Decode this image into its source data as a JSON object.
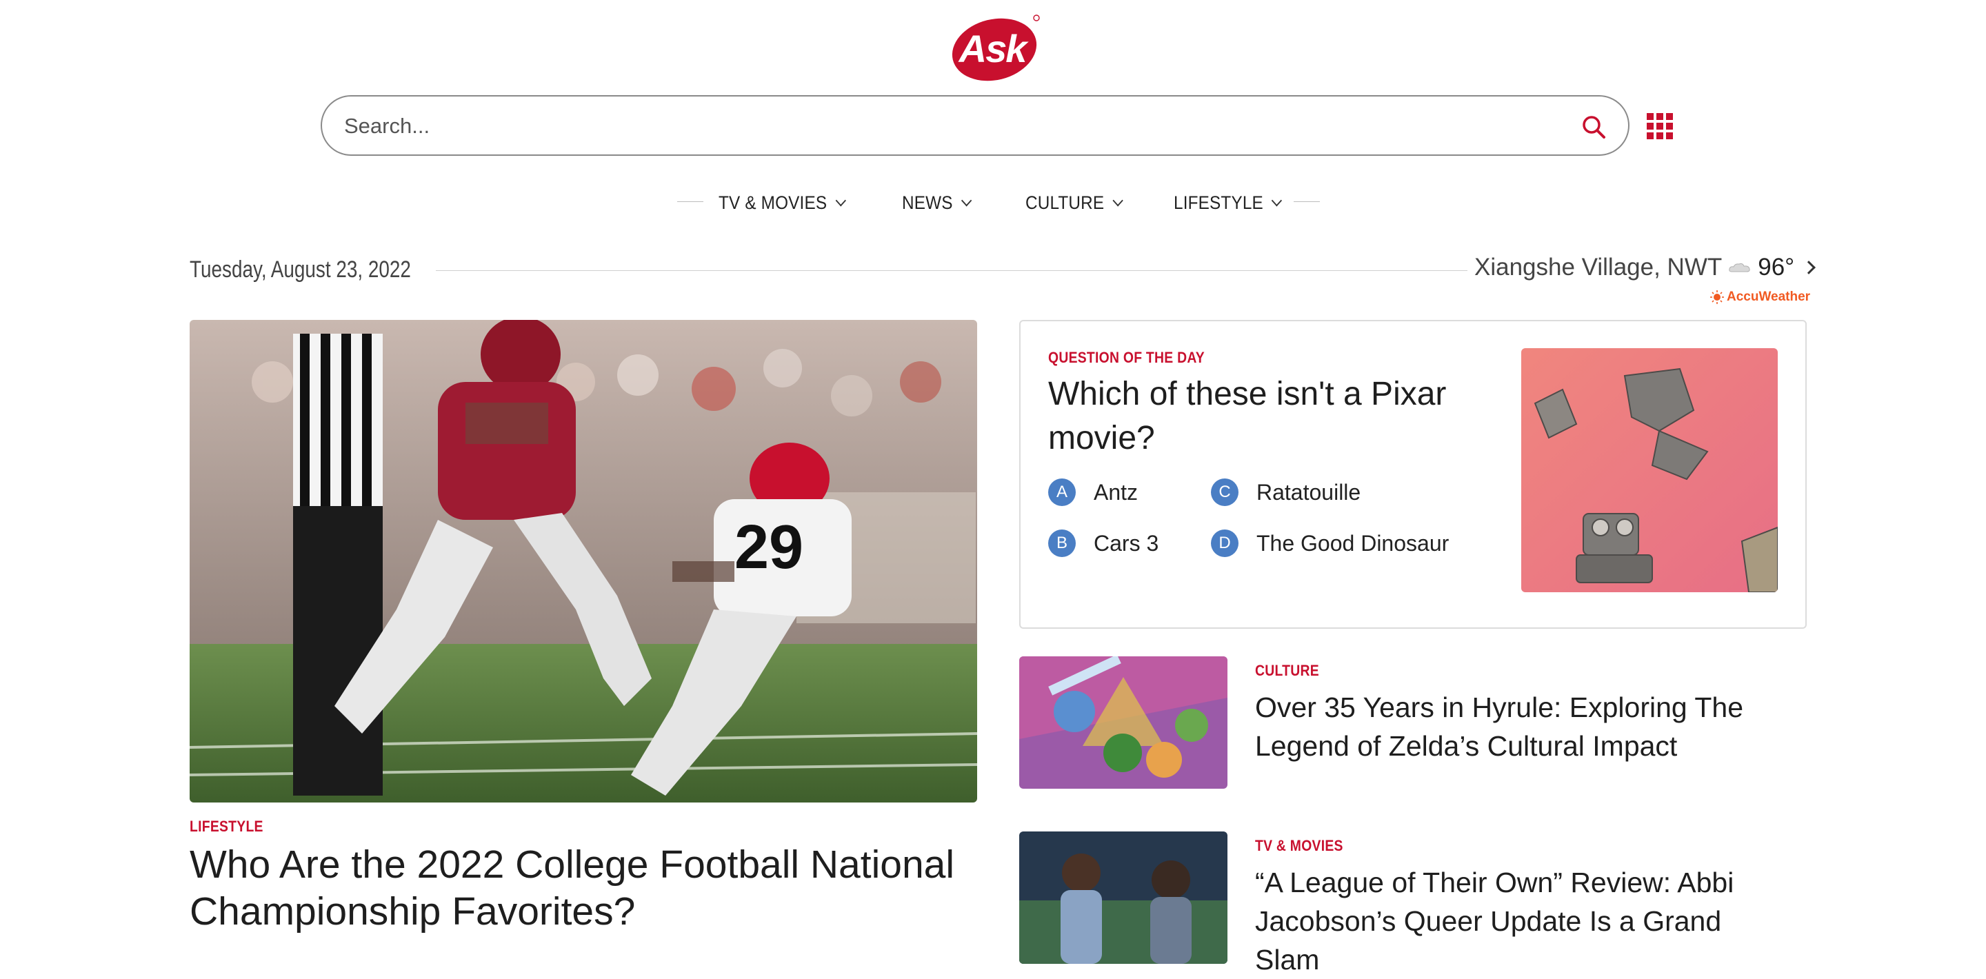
{
  "logo": {
    "text": "Ask"
  },
  "search": {
    "placeholder": "Search..."
  },
  "nav": {
    "items": [
      {
        "label": "TV & MOVIES"
      },
      {
        "label": "NEWS"
      },
      {
        "label": "CULTURE"
      },
      {
        "label": "LIFESTYLE"
      }
    ]
  },
  "date": "Tuesday, August 23, 2022",
  "weather": {
    "location": "Xiangshe Village, NWT",
    "temp": "96°",
    "provider": "AccuWeather"
  },
  "hero": {
    "category": "LIFESTYLE",
    "title": "Who Are the 2022 College Football National Championship Favorites?"
  },
  "qotd": {
    "label": "QUESTION OF THE DAY",
    "question": "Which of these isn't a Pixar movie?",
    "answers": [
      {
        "letter": "A",
        "text": "Antz"
      },
      {
        "letter": "B",
        "text": "Cars 3"
      },
      {
        "letter": "C",
        "text": "Ratatouille"
      },
      {
        "letter": "D",
        "text": "The Good Dinosaur"
      }
    ]
  },
  "articles": [
    {
      "category": "CULTURE",
      "title": "Over 35 Years in Hyrule: Exploring The Legend of Zelda’s Cultural Impact"
    },
    {
      "category": "TV & MOVIES",
      "title": "“A League of Their Own” Review: Abbi Jacobson’s Queer Update Is a Grand Slam"
    }
  ],
  "colors": {
    "brand": "#c8102e",
    "answer_dot": "#4a7ec4",
    "accuweather": "#f15a22"
  },
  "icons": [
    "search-icon",
    "apps-grid-icon",
    "chevron-down-icon",
    "weather-cloud-icon",
    "chevron-right-icon",
    "accuweather-sun-icon"
  ]
}
